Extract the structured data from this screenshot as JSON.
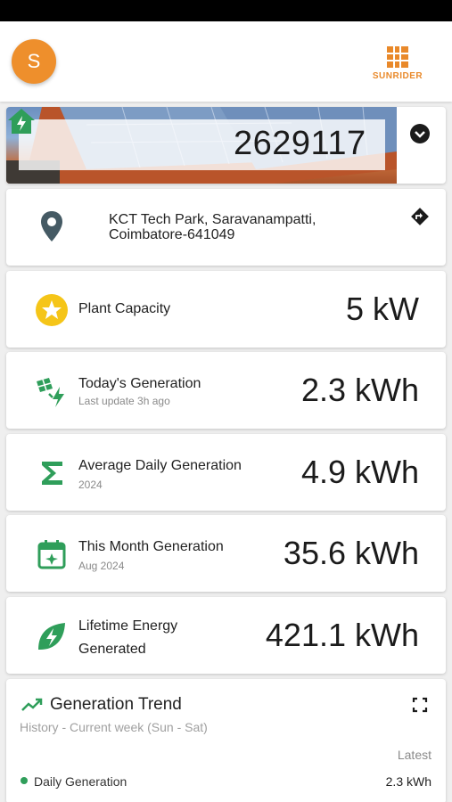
{
  "user": {
    "initial": "S"
  },
  "brand": {
    "name": "SUNRIDER"
  },
  "plant": {
    "id": "2629117",
    "address": "KCT Tech Park, Saravanampatti, Coimbatore-641049"
  },
  "stats": [
    {
      "label": "Plant Capacity",
      "sub": "",
      "value": "5 kW",
      "icon": "star-icon"
    },
    {
      "label": "Today's Generation",
      "sub": "Last update 3h ago",
      "value": "2.3 kWh",
      "icon": "solar-panel-bolt-icon"
    },
    {
      "label": "Average Daily Generation",
      "sub": "2024",
      "value": "4.9 kWh",
      "icon": "sigma-icon"
    },
    {
      "label": "This Month Generation",
      "sub": "Aug 2024",
      "value": "35.6 kWh",
      "icon": "calendar-icon"
    },
    {
      "label": "Lifetime Energy Generated",
      "sub": "",
      "value": "421.1 kWh",
      "icon": "eco-bolt-icon"
    }
  ],
  "trend": {
    "title": "Generation Trend",
    "subtitle": "History - Current week (Sun - Sat)",
    "latest_label": "Latest",
    "legend": {
      "name": "Daily Generation",
      "value": "2.3 kWh"
    }
  },
  "colors": {
    "accent": "#ee8f2c",
    "green": "#2f9e5a"
  }
}
